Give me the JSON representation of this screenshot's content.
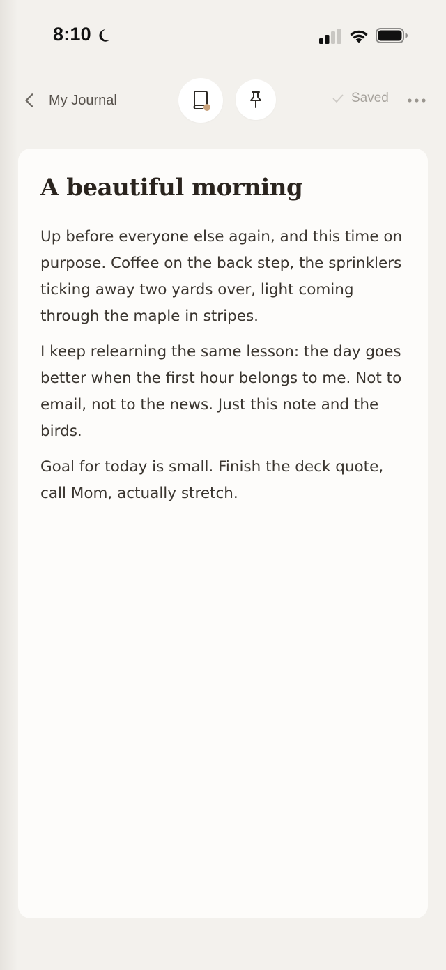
{
  "status_bar": {
    "time": "8:10",
    "icons": [
      "moon-icon",
      "signal-icon",
      "wifi-icon",
      "battery-icon"
    ]
  },
  "header": {
    "back_label": "My Journal",
    "journal_button_icon": "journal-book-icon",
    "pin_button_icon": "pin-icon",
    "saved_label": "Saved",
    "more_icon": "more-dots-icon"
  },
  "note": {
    "title": "A beautiful morning",
    "paragraphs": [
      "Up before everyone else again, and this time on purpose. Coffee on the back step, the sprinklers ticking away two yards over, light coming through the maple in stripes.",
      "I keep relearning the same lesson: the day goes better when the first hour belongs to me. Not to email, not to the news. Just this note and the birds.",
      "Goal for today is small. Finish the deck quote, call Mom, actually stretch."
    ]
  },
  "colors": {
    "background": "#f3f1ed",
    "card": "#fdfcfa",
    "accent_dot": "#c8a27c",
    "title_text": "#2a241e",
    "muted_text": "#a6a29c"
  }
}
